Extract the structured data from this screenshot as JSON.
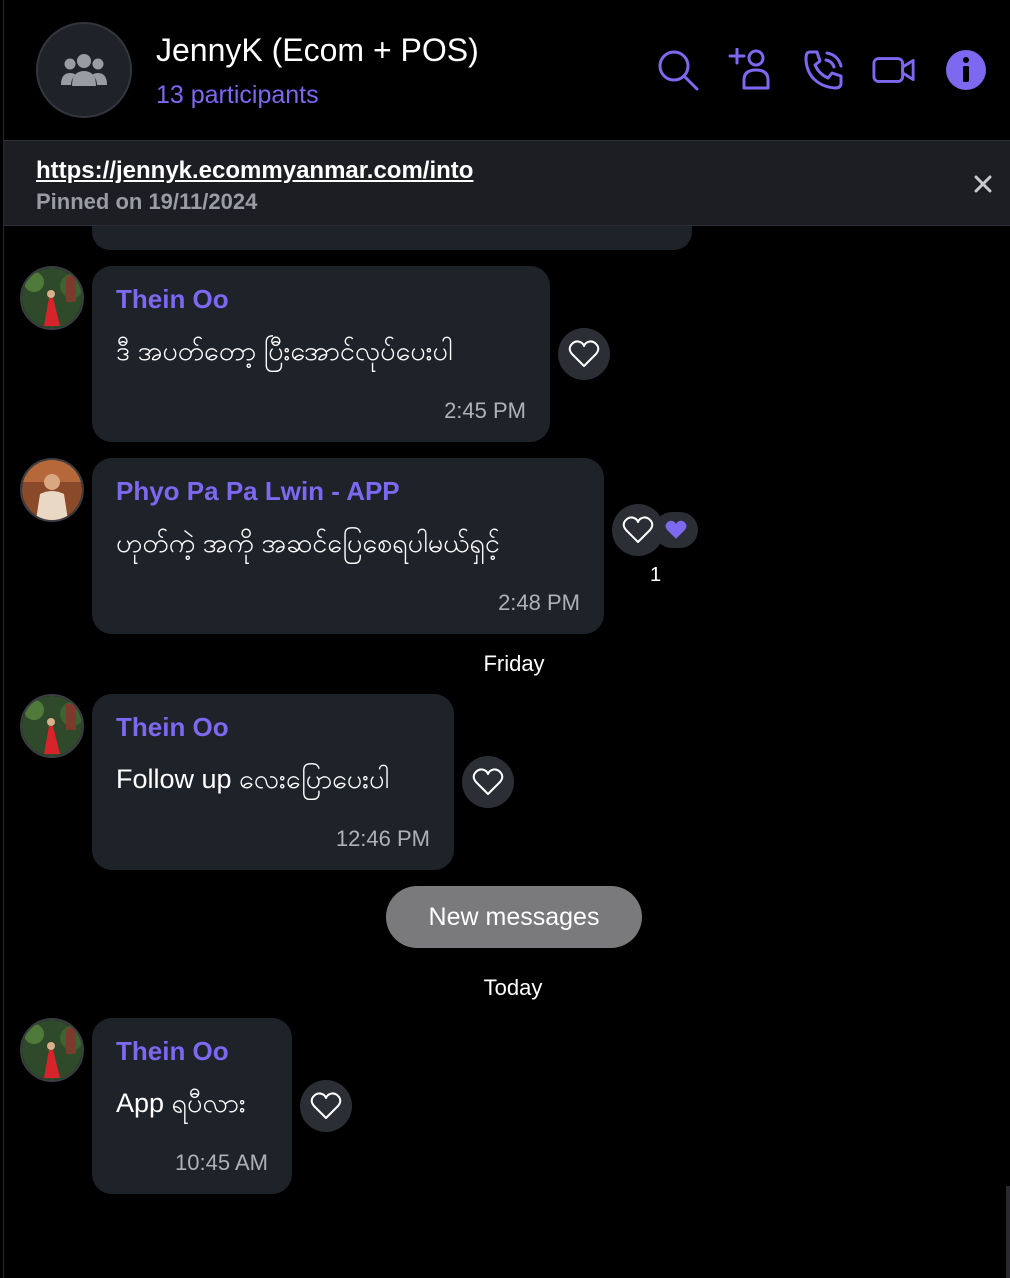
{
  "header": {
    "title": "JennyK (Ecom + POS)",
    "participants": "13 participants",
    "icons": [
      "search-icon",
      "add-participant-icon",
      "voice-call-icon",
      "video-call-icon",
      "info-icon"
    ],
    "accent_color": "#7d68f0"
  },
  "pinned": {
    "link": "https://jennyk.ecommyanmar.com/into",
    "date": "Pinned on 19/11/2024"
  },
  "messages": [
    {
      "sender": "Thein Oo",
      "text": "ဒီ အပတ်တော့ ပြီးအောင်လုပ်ပေးပါ",
      "time": "2:45 PM"
    },
    {
      "sender": "Phyo Pa Pa Lwin - APP",
      "text": "ဟုတ်ကဲ့ အကို အဆင်ပြေစေရပါမယ်ရှင့်",
      "time": "2:48 PM",
      "reaction_count": "1"
    },
    {
      "sender": "Thein Oo",
      "text": "Follow up လေးပြောပေးပါ",
      "time": "12:46 PM"
    },
    {
      "sender": "Thein Oo",
      "text": "App ရပီလား",
      "time": "10:45 AM"
    }
  ],
  "separators": {
    "friday": "Friday",
    "today": "Today"
  },
  "new_messages_label": "New messages"
}
